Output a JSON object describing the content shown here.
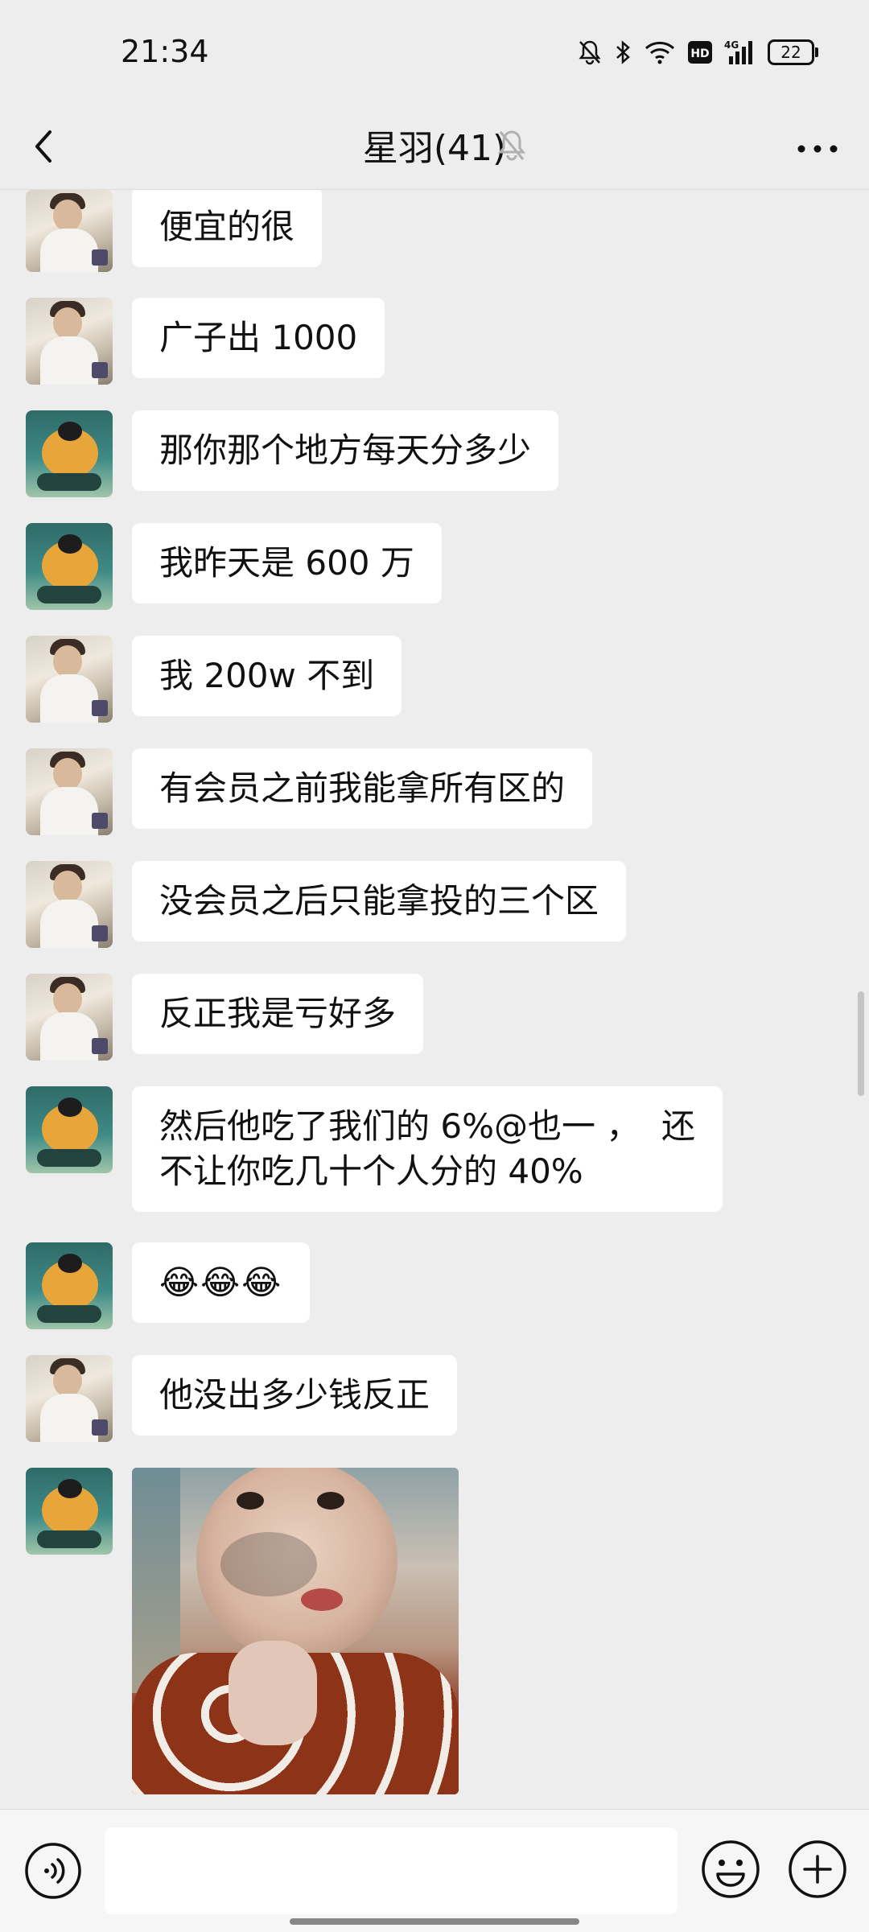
{
  "status_bar": {
    "time": "21:34",
    "icons": [
      "mute-bell-icon",
      "bluetooth-icon",
      "wifi-icon",
      "hd-icon",
      "4g-signal-icon",
      "battery-icon"
    ],
    "hd_label": "HD",
    "network_label": "4G",
    "battery_level": "22"
  },
  "header": {
    "title": "星羽(41)",
    "back_icon": "chevron-left-icon",
    "mute_icon": "muted-bell-icon",
    "more_icon": "more-dots-icon"
  },
  "messages": [
    {
      "sender": "a",
      "text": "便宜的很"
    },
    {
      "sender": "a",
      "text": "广子出 1000"
    },
    {
      "sender": "b",
      "text": "那你那个地方每天分多少"
    },
    {
      "sender": "b",
      "text": "我昨天是 600 万"
    },
    {
      "sender": "a",
      "text": "我 200w 不到"
    },
    {
      "sender": "a",
      "text": "有会员之前我能拿所有区的"
    },
    {
      "sender": "a",
      "text": "没会员之后只能拿投的三个区"
    },
    {
      "sender": "a",
      "text": "反正我是亏好多"
    },
    {
      "sender": "b",
      "text": "然后他吃了我们的 6%@也一 ，  还\n不让你吃几十个人分的 40%"
    },
    {
      "sender": "b",
      "text": "😂😂😂"
    },
    {
      "sender": "a",
      "text": "他没出多少钱反正"
    },
    {
      "sender": "b",
      "type": "image",
      "image": "baby-photo"
    }
  ],
  "input_bar": {
    "voice_icon": "voice-icon",
    "placeholder": "",
    "emoji_icon": "emoji-icon",
    "plus_icon": "plus-icon"
  }
}
